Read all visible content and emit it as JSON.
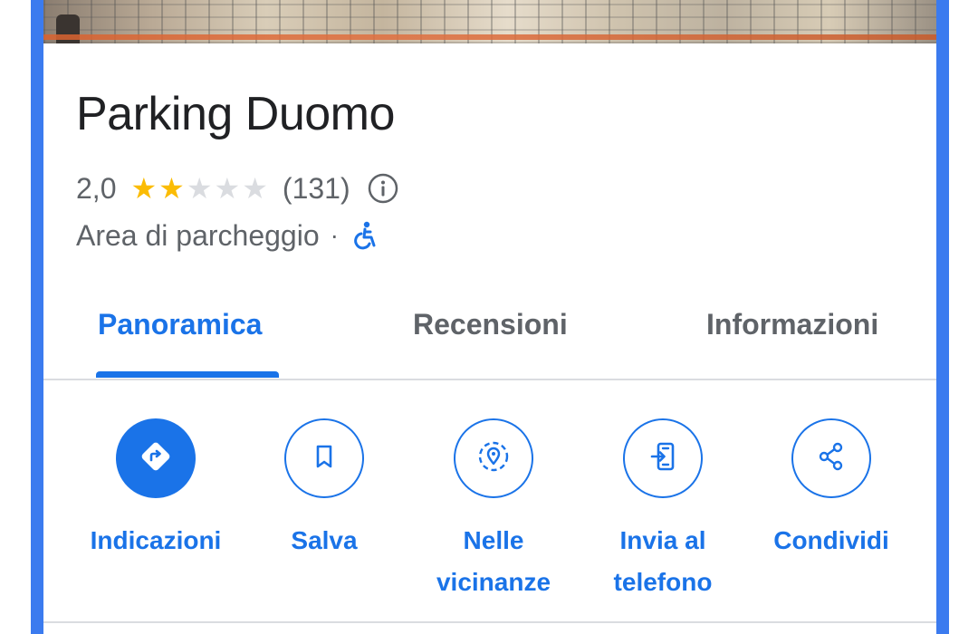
{
  "place": {
    "name": "Parking Duomo",
    "rating": "2,0",
    "stars_filled": 2,
    "stars_total": 5,
    "review_count": "(131)",
    "category": "Area di parcheggio",
    "separator": "·",
    "accessible_icon": "wheelchair-icon"
  },
  "tabs": [
    {
      "label": "Panoramica",
      "active": true
    },
    {
      "label": "Recensioni",
      "active": false
    },
    {
      "label": "Informazioni",
      "active": false
    }
  ],
  "actions": [
    {
      "label": "Indicazioni",
      "icon": "directions-icon"
    },
    {
      "label": "Salva",
      "icon": "bookmark-icon"
    },
    {
      "label": "Nelle vicinanze",
      "icon": "nearby-icon"
    },
    {
      "label": "Invia al telefono",
      "icon": "send-to-phone-icon"
    },
    {
      "label": "Condividi",
      "icon": "share-icon"
    }
  ],
  "colors": {
    "accent": "#1a73e8",
    "frame": "#3b7bef",
    "star": "#fbbc04",
    "star_off": "#dadce0",
    "text_secondary": "#5f6368"
  }
}
